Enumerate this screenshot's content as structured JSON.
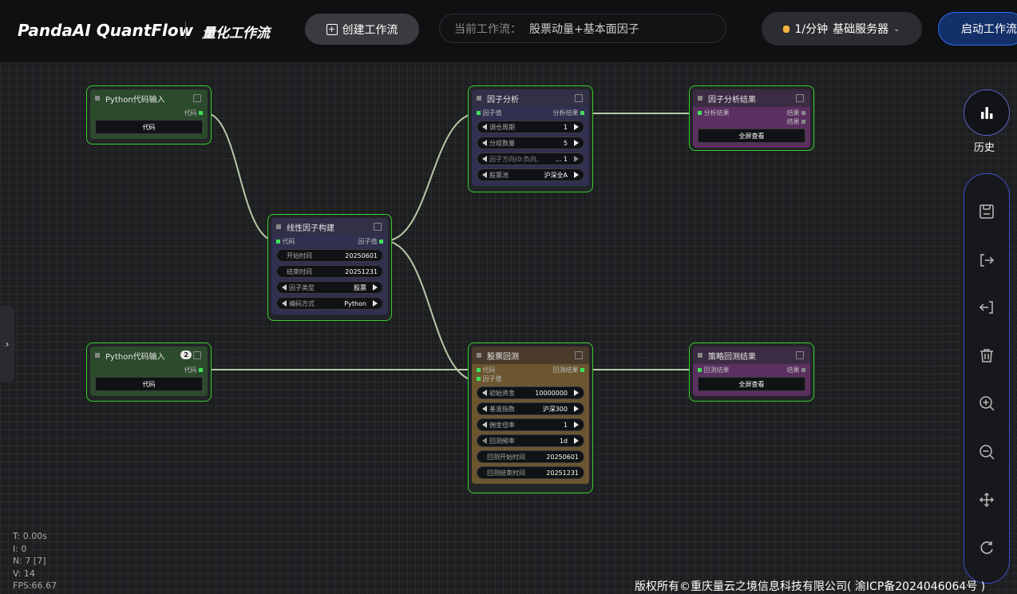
{
  "header": {
    "brand": "PandaAI QuantFlow",
    "subtitle": "量化工作流",
    "create_button": "创建工作流",
    "current_label": "当前工作流：",
    "current_value": "股票动量+基本面因子",
    "rate_label": "1/分钟",
    "server_label": "基础服务器",
    "start_button": "启动工作流"
  },
  "nodes": {
    "py1": {
      "title": "Python代码输入",
      "out": "代码",
      "button": "代码"
    },
    "py2": {
      "title": "Python代码输入",
      "badge": "2",
      "out": "代码",
      "button": "代码"
    },
    "linear": {
      "title": "线性因子构建",
      "in": "代码",
      "out": "因子值",
      "fields": [
        {
          "label": "开始时间",
          "value": "20250601"
        },
        {
          "label": "结束时间",
          "value": "20251231"
        },
        {
          "label": "因子类型",
          "value": "股票"
        },
        {
          "label": "编码方式",
          "value": "Python"
        }
      ]
    },
    "analysis": {
      "title": "因子分析",
      "in": "因子值",
      "out": "分析结果",
      "fields": [
        {
          "label": "调仓周期",
          "value": "1"
        },
        {
          "label": "分组数量",
          "value": "5"
        },
        {
          "label": "因子方向(0:负向,",
          "value": "... 1"
        },
        {
          "label": "股票池",
          "value": "沪深全A"
        }
      ]
    },
    "analysis_result": {
      "title": "因子分析结果",
      "in": "分析结果",
      "out1": "结果",
      "out2": "结果",
      "button": "全屏查看"
    },
    "backtest": {
      "title": "股票回测",
      "in1": "代码",
      "in2": "因子值",
      "out": "回测结果",
      "fields": [
        {
          "label": "初始资金",
          "value": "10000000"
        },
        {
          "label": "基准指数",
          "value": "沪深300"
        },
        {
          "label": "佣金倍率",
          "value": "1"
        },
        {
          "label": "回测频率",
          "value": "1d"
        },
        {
          "label": "回测开始时间",
          "value": "20250601"
        },
        {
          "label": "回测结束时间",
          "value": "20251231"
        }
      ]
    },
    "backtest_result": {
      "title": "策略回测结果",
      "in": "回测结果",
      "out": "结果",
      "button": "全屏查看"
    }
  },
  "sidebar": {
    "history_label": "历史"
  },
  "stats": {
    "t": "T: 0.00s",
    "i": "I: 0",
    "n": "N: 7 [7]",
    "v": "V: 14",
    "fps": "FPS:66.67"
  },
  "footer": {
    "text": "版权所有©重庆量云之境信息科技有限公司( 渝ICP备2024046064号 )"
  },
  "colors": {
    "node_border": "#35d02a",
    "wire": "#b5c9a8",
    "accent": "#2f6bf0"
  }
}
